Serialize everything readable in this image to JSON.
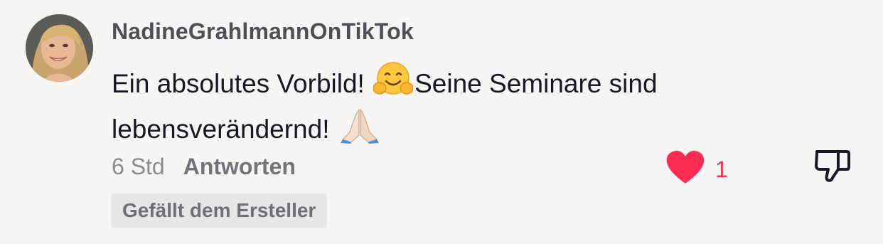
{
  "comment": {
    "username": "NadineGrahlmannOnTikTok",
    "text_part1": "Ein absolutes Vorbild! ",
    "emoji1_icon": "smiling-hugging-face-icon",
    "text_part2": "Seine Seminare sind lebensverändernd! ",
    "emoji2_icon": "folded-hands-icon",
    "time": "6 Std",
    "reply_label": "Antworten",
    "like_count": "1",
    "liked": true,
    "creator_badge": "Gefällt dem Ersteller"
  },
  "colors": {
    "like_red": "#fe2c55",
    "background": "#f6f5f4"
  }
}
